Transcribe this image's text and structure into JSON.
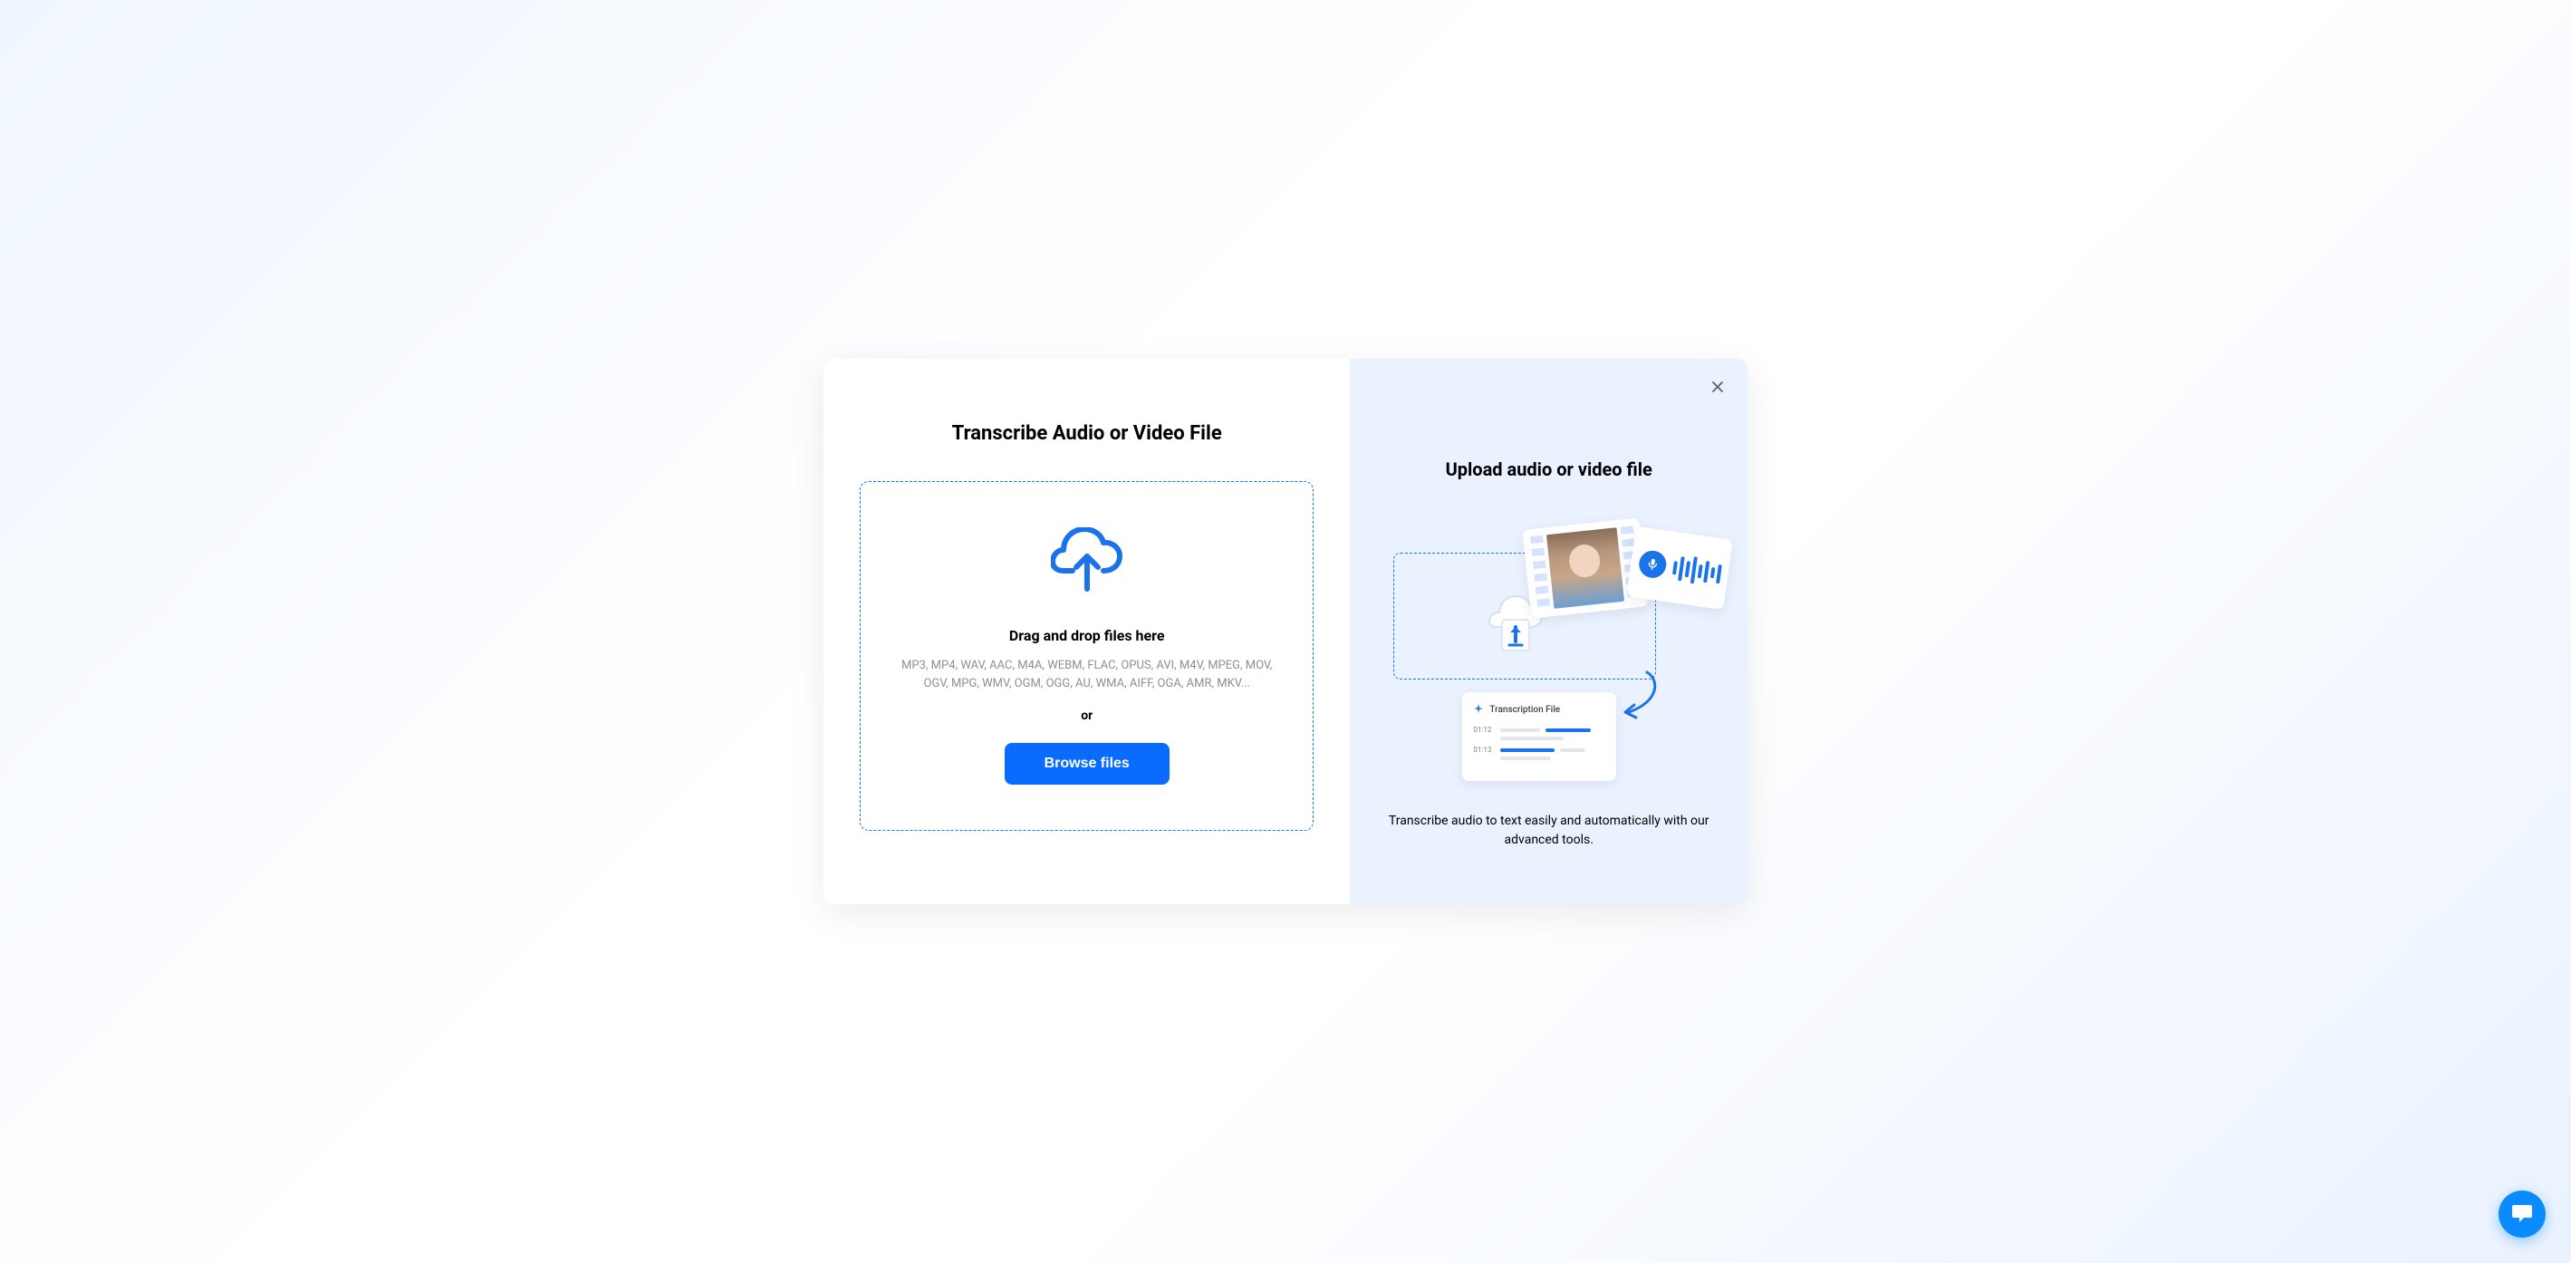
{
  "left": {
    "title": "Transcribe Audio or Video File",
    "drop_text": "Drag and drop files here",
    "formats": "MP3, MP4, WAV, AAC, M4A, WEBM, FLAC, OPUS, AVI, M4V, MPEG, MOV, OGV, MPG, WMV, OGM, OGG, AU, WMA, AIFF, OGA, AMR, MKV...",
    "or": "or",
    "browse_label": "Browse files"
  },
  "right": {
    "title": "Upload audio or video file",
    "description": "Transcribe audio to text easily and automatically with our advanced tools.",
    "transcript_card": {
      "title": "Transcription File",
      "row1_time": "01:12",
      "row2_time": "01:13"
    }
  }
}
